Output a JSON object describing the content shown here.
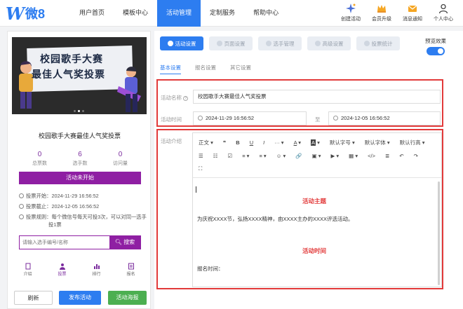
{
  "logo": {
    "text": "微8"
  },
  "nav": {
    "items": [
      "用户首页",
      "模板中心",
      "活动管理",
      "定制服务",
      "帮助中心"
    ],
    "active_index": 2
  },
  "tools": [
    {
      "label": "创建活动",
      "icon": "sparkle-icon"
    },
    {
      "label": "会员升级",
      "icon": "crown-icon"
    },
    {
      "label": "消息通知",
      "icon": "mail-icon"
    },
    {
      "label": "个人中心",
      "icon": "user-icon"
    }
  ],
  "preview": {
    "banner_line1": "校园歌手大赛",
    "banner_line2": "最佳人气奖投票",
    "title": "校园歌手大赛最佳人气奖投票",
    "stats": [
      {
        "value": "0",
        "label": "总票数"
      },
      {
        "value": "6",
        "label": "选手数"
      },
      {
        "value": "0",
        "label": "访问量"
      }
    ],
    "status_button": "活动未开始",
    "vote_start": "投票开始：2024-11-29 16:56:52",
    "vote_end": "投票截止：2024-12-05 16:56:52",
    "rule_line1": "投票规则：每个微信号每天可投3次，可以对同一选手",
    "rule_line2": "投1票",
    "search_placeholder": "请输入选手编号/名称",
    "search_button": "搜索",
    "bottom_tabs": [
      "介绍",
      "投票",
      "排行",
      "报名"
    ],
    "bottom_active_index": 1
  },
  "actions": {
    "refresh": "刷新",
    "publish": "发布活动",
    "poster": "活动海报"
  },
  "steps": {
    "items": [
      "活动设置",
      "页面设置",
      "选手管理",
      "高级设置",
      "投票统计"
    ],
    "active_index": 0
  },
  "preview_effect": {
    "label": "预览效果",
    "on": true
  },
  "subtabs": {
    "items": [
      "基本设置",
      "报名设置",
      "其它设置"
    ],
    "active_index": 0
  },
  "form": {
    "name_label": "活动名称",
    "name_value": "校园歌手大赛最佳人气奖投票",
    "time_label": "活动时间",
    "start_time": "2024-11-29 16:56:52",
    "to_label": "至",
    "end_time": "2024-12-05 16:56:52",
    "intro_label": "活动介绍"
  },
  "editor": {
    "toolbar_row1": [
      "正文",
      "❝",
      "B",
      "U",
      "I",
      "···",
      "A",
      "A",
      "默认字号",
      "默认字体",
      "默认行高"
    ],
    "toolbar_row2": [
      "☰",
      "☷",
      "☑",
      "≡",
      "≡",
      "☺",
      "🔗",
      "▣",
      "▶",
      "▦",
      "</>",
      "≣",
      "↶",
      "↷"
    ],
    "toolbar_row3": [
      "⛶"
    ],
    "heading1": "活动主题",
    "paragraph1": "为庆祝XXXX节，弘扬XXXX精神，由XXXX主办的XXXX评选活动。",
    "heading2": "活动时间",
    "paragraph2": "报名时间："
  }
}
